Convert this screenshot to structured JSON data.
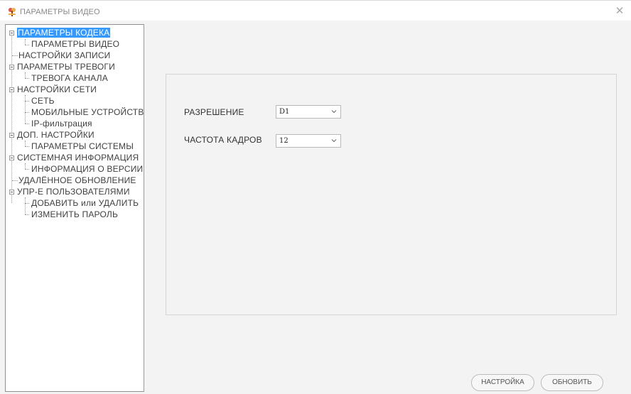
{
  "window": {
    "title": "ПАРАМЕТРЫ ВИДЕО",
    "app_icon": "app-tool-icon",
    "close_icon": "close-icon"
  },
  "tree": {
    "items": [
      {
        "label": "ПАРАМЕТРЫ КОДЕКА",
        "selected": true
      },
      {
        "label": "ПАРАМЕТРЫ ВИДЕО"
      },
      {
        "label": "НАСТРОЙКИ ЗАПИСИ"
      },
      {
        "label": "ПАРАМЕТРЫ ТРЕВОГИ"
      },
      {
        "label": "ТРЕВОГА КАНАЛА"
      },
      {
        "label": "НАСТРОЙКИ СЕТИ"
      },
      {
        "label": "СЕТЬ"
      },
      {
        "label": "МОБИЛЬНЫЕ УСТРОЙСТВ"
      },
      {
        "label": "IP-фильтрация"
      },
      {
        "label": "ДОП. НАСТРОЙКИ"
      },
      {
        "label": "ПАРАМЕТРЫ СИСТЕМЫ"
      },
      {
        "label": "СИСТЕМНАЯ ИНФОРМАЦИЯ"
      },
      {
        "label": "ИНФОРМАЦИЯ О ВЕРСИИ"
      },
      {
        "label": "УДАЛЁННОЕ ОБНОВЛЕНИЕ"
      },
      {
        "label": "УПР-Е ПОЛЬЗОВАТЕЛЯМИ"
      },
      {
        "label": "ДОБАВИТЬ или УДАЛИТЬ"
      },
      {
        "label": "ИЗМЕНИТЬ ПАРОЛЬ"
      }
    ]
  },
  "form": {
    "resolution_label": "РАЗРЕШЕНИЕ",
    "resolution_value": "D1",
    "framerate_label": "ЧАСТОТА КАДРОВ",
    "framerate_value": "12"
  },
  "buttons": {
    "settings": "НАСТРОЙКА",
    "refresh": "ОБНОВИТЬ"
  },
  "colors": {
    "selection": "#3399ff",
    "background": "#f3f3f3"
  }
}
